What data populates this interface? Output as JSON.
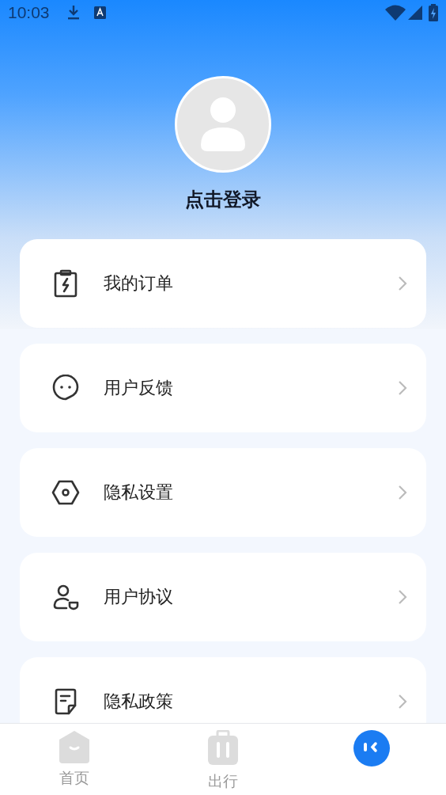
{
  "status_bar": {
    "time": "10:03"
  },
  "profile": {
    "login_label": "点击登录"
  },
  "menu": [
    {
      "label": "我的订单"
    },
    {
      "label": "用户反馈"
    },
    {
      "label": "隐私设置"
    },
    {
      "label": "用户协议"
    },
    {
      "label": "隐私政策"
    }
  ],
  "tab_bar": [
    {
      "label": "首页",
      "selected": false
    },
    {
      "label": "出行",
      "selected": false
    },
    {
      "selected": true
    }
  ]
}
